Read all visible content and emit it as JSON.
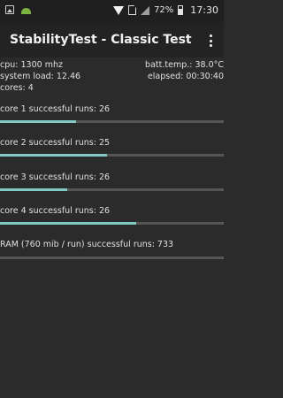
{
  "status_bar": {
    "icons_left": [
      "gallery-icon",
      "android-icon"
    ],
    "icons_right": [
      "wifi-icon",
      "sim-icon",
      "signal-icon",
      "battery-icon"
    ],
    "battery_percent": "72%",
    "time": "17:30"
  },
  "app": {
    "title": "StabilityTest - Classic Test",
    "menu_icon": "overflow-menu-icon"
  },
  "info": {
    "cpu": "cpu: 1300 mhz",
    "batt_temp": "batt.temp.: 38.0°C",
    "system_load": "system load: 12.46",
    "elapsed": "elapsed: 00:30:40",
    "cores": "cores: 4"
  },
  "cores": [
    {
      "label": "core 1 successful runs: 26",
      "progress": 0.34
    },
    {
      "label": "core 2 successful runs: 25",
      "progress": 0.48
    },
    {
      "label": "core 3 successful runs: 26",
      "progress": 0.3
    },
    {
      "label": "core 4 successful runs: 26",
      "progress": 0.61
    }
  ],
  "ram": {
    "label": "RAM (760 mib / run) successful runs: 733",
    "progress": 0.0
  },
  "colors": {
    "background": "#2b2b2b",
    "toolbar": "#232323",
    "progress_fill": "#80cbc4",
    "progress_track": "#555555"
  }
}
